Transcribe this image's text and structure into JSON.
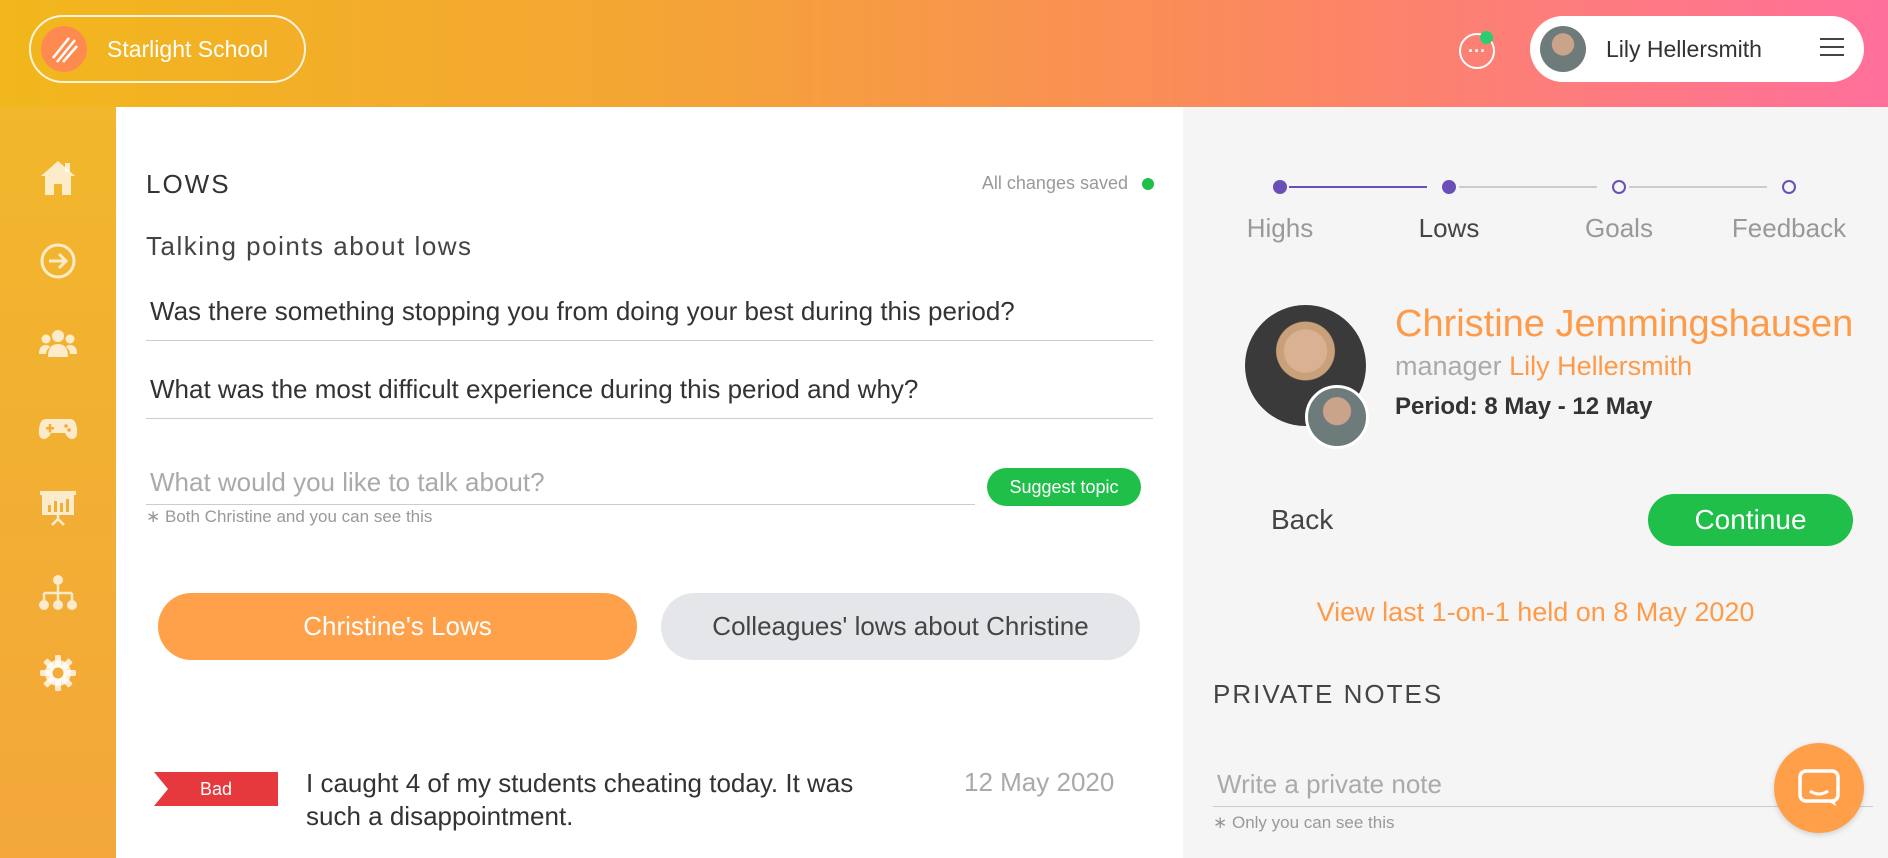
{
  "header": {
    "school_name": "Starlight School",
    "chat_icon_glyph": "···",
    "user_name": "Lily Hellersmith"
  },
  "sidebar": {
    "items": [
      {
        "icon": "home-icon"
      },
      {
        "icon": "arrow-right-circle-icon"
      },
      {
        "icon": "people-icon"
      },
      {
        "icon": "gamepad-icon"
      },
      {
        "icon": "presentation-board-icon"
      },
      {
        "icon": "org-chart-icon"
      },
      {
        "icon": "gear-icon"
      }
    ]
  },
  "main": {
    "section_title": "LOWS",
    "save_status": "All changes saved",
    "subtitle": "Talking points about lows",
    "questions": [
      "Was there something stopping you from doing your best during this period?",
      "What was the most difficult experience during this period and why?"
    ],
    "topic_placeholder": "What would you like to talk about?",
    "suggest_label": "Suggest topic",
    "visibility_note": "∗ Both Christine and you can see this",
    "tabs": [
      {
        "label": "Christine's Lows",
        "active": true
      },
      {
        "label": "Colleagues' lows about Christine",
        "active": false
      }
    ],
    "entries": [
      {
        "tag": "Bad",
        "text": "I caught 4 of my students cheating today. It was such a disappointment.",
        "date": "12 May 2020"
      }
    ]
  },
  "stepper": {
    "steps": [
      {
        "label": "Highs",
        "state": "done"
      },
      {
        "label": "Lows",
        "state": "current"
      },
      {
        "label": "Goals",
        "state": "upcoming"
      },
      {
        "label": "Feedback",
        "state": "upcoming"
      }
    ]
  },
  "profile": {
    "name": "Christine Jemmingshausen",
    "manager_label": "manager",
    "manager_name": "Lily Hellersmith",
    "period": "Period: 8 May - 12 May"
  },
  "actions": {
    "back_label": "Back",
    "continue_label": "Continue",
    "view_last": "View last 1-on-1 held on 8 May 2020"
  },
  "private_notes": {
    "title": "PRIVATE NOTES",
    "placeholder": "Write a private note",
    "note": "∗ Only you can see this"
  },
  "colors": {
    "accent_orange": "#ff9a48",
    "success_green": "#1fbf4a",
    "stepper_purple": "#6a4fb8",
    "bad_red": "#e5393e"
  }
}
